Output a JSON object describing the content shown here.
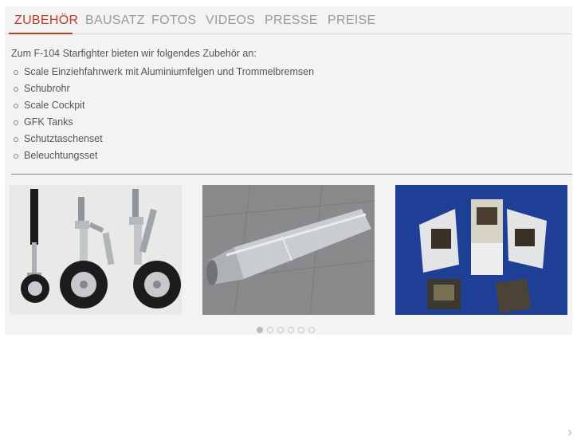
{
  "tabs": [
    {
      "label": "ZUBEHÖR",
      "active": true
    },
    {
      "label": "BAUSATZ",
      "active": false
    },
    {
      "label": "FOTOS",
      "active": false
    },
    {
      "label": "VIDEOS",
      "active": false
    },
    {
      "label": "PRESSE",
      "active": false
    },
    {
      "label": "PREISE",
      "active": false
    }
  ],
  "content": {
    "intro": "Zum F-104 Starfighter bieten wir folgendes Zubehör an:",
    "items": [
      "Scale Einziehfahrwerk mit Aluminiumfelgen und Trommelbremsen",
      "Schubrohr",
      "Scale Cockpit",
      "GFK Tanks",
      "Schutztaschenset",
      "Beleuchtungsset"
    ]
  },
  "carousel": {
    "dot_count": 6,
    "active_index": 0
  },
  "colors": {
    "accent": "#c0392b",
    "panel_bg": "#f3f3f3",
    "tab_inactive": "#9a9a9a",
    "text": "#555555"
  }
}
